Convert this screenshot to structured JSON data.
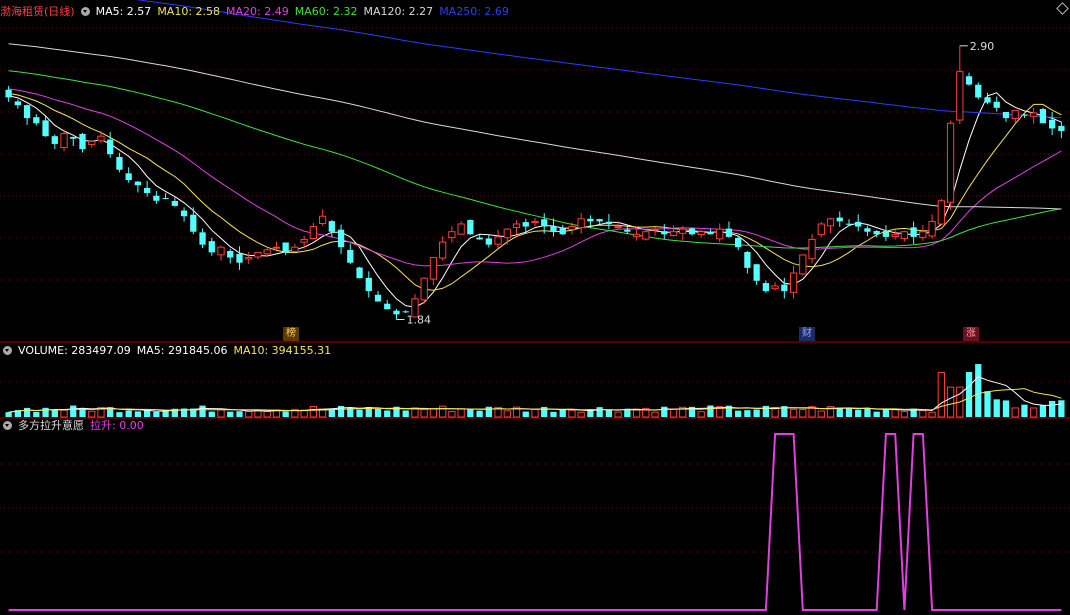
{
  "price_panel": {
    "title": "渤海租赁(日线)",
    "indicators": [
      {
        "label": "MA5: 2.57",
        "color": "#ffffff"
      },
      {
        "label": "MA10: 2.58",
        "color": "#f5e35a"
      },
      {
        "label": "MA20: 2.49",
        "color": "#e040e0"
      },
      {
        "label": "MA60: 2.32",
        "color": "#40e040"
      },
      {
        "label": "MA120: 2.27",
        "color": "#d8d8d8"
      },
      {
        "label": "MA250: 2.69",
        "color": "#2a3cff"
      }
    ],
    "high_label": "2.90",
    "low_label": "1.84",
    "markers": [
      "榜",
      "财",
      "涨"
    ]
  },
  "volume_panel": {
    "indicators": [
      {
        "label": "VOLUME: 283497.09",
        "color": "#ffffff"
      },
      {
        "label": "MA5: 291845.06",
        "color": "#ffffff"
      },
      {
        "label": "MA10: 394155.31",
        "color": "#f5e35a"
      }
    ]
  },
  "signal_panel": {
    "title": "多方拉升意愿",
    "indicator": {
      "label": "拉升: 0.00",
      "color": "#e040e0"
    }
  },
  "colors": {
    "up": "#ff3c3c",
    "down": "#54ffff",
    "grid": "#7a0000",
    "divider": "#a00000",
    "signal": "#e040e0"
  },
  "chart_data": {
    "type": "candlestick",
    "ylim": [
      1.78,
      3.0
    ],
    "closes": [
      2.7,
      2.67,
      2.62,
      2.6,
      2.55,
      2.52,
      2.56,
      2.54,
      2.5,
      2.53,
      2.55,
      2.48,
      2.42,
      2.38,
      2.36,
      2.33,
      2.3,
      2.31,
      2.28,
      2.24,
      2.18,
      2.13,
      2.1,
      2.12,
      2.08,
      2.06,
      2.08,
      2.1,
      2.11,
      2.12,
      2.1,
      2.12,
      2.15,
      2.2,
      2.24,
      2.18,
      2.12,
      2.06,
      2.0,
      1.95,
      1.91,
      1.88,
      1.86,
      1.87,
      1.92,
      2.0,
      2.08,
      2.14,
      2.18,
      2.21,
      2.17,
      2.15,
      2.13,
      2.16,
      2.19,
      2.21,
      2.2,
      2.22,
      2.2,
      2.18,
      2.17,
      2.2,
      2.23,
      2.22,
      2.22,
      2.21,
      2.2,
      2.18,
      2.17,
      2.18,
      2.19,
      2.17,
      2.18,
      2.19,
      2.17,
      2.18,
      2.17,
      2.19,
      2.16,
      2.12,
      2.04,
      1.99,
      1.95,
      1.97,
      1.95,
      2.02,
      2.09,
      2.15,
      2.21,
      2.23,
      2.22,
      2.21,
      2.2,
      2.18,
      2.17,
      2.16,
      2.17,
      2.18,
      2.16,
      2.18,
      2.22,
      2.3,
      2.6,
      2.8,
      2.75,
      2.7,
      2.68,
      2.66,
      2.62,
      2.65,
      2.63,
      2.64,
      2.6,
      2.58,
      2.57
    ],
    "high_point": 2.9,
    "low_point": 1.84,
    "ma_series": [
      {
        "name": "MA5",
        "period": 5,
        "color": "#ffffff"
      },
      {
        "name": "MA10",
        "period": 10,
        "color": "#f5e35a"
      },
      {
        "name": "MA20",
        "period": 20,
        "color": "#e040e0"
      },
      {
        "name": "MA60",
        "period": 60,
        "color": "#40e040"
      },
      {
        "name": "MA120",
        "period": 120,
        "color": "#d8d8d8"
      },
      {
        "name": "MA250",
        "period": 250,
        "color": "#2a3cff"
      }
    ],
    "volume": {
      "ylim": [
        0,
        1000000
      ],
      "last": 283497.09,
      "ma5_last": 291845.06,
      "ma10_last": 394155.31
    },
    "signal": {
      "ylim": [
        0,
        1
      ],
      "pulses": [
        {
          "start": 83,
          "end": 85
        },
        {
          "start": 95,
          "end": 96
        },
        {
          "start": 98,
          "end": 99
        }
      ],
      "last": 0.0
    }
  }
}
